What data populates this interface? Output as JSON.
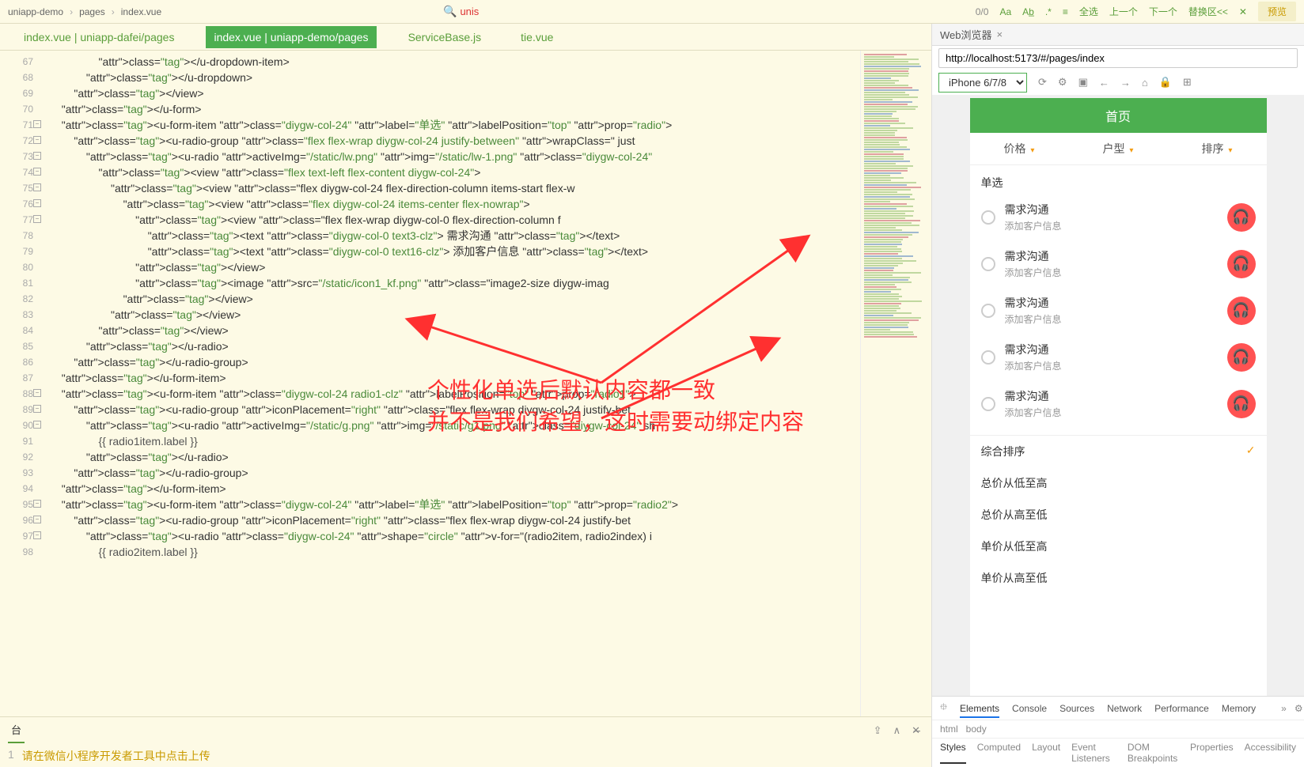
{
  "breadcrumb": [
    "uniapp-demo",
    "pages",
    "index.vue"
  ],
  "search_value": "unis",
  "match_count": "0/0",
  "toolbar_actions": {
    "select_all": "全选",
    "prev": "上一个",
    "next": "下一个",
    "replace": "替换区<<",
    "preview": "预览"
  },
  "editor_tabs": [
    {
      "label": "index.vue | uniapp-dafei/pages",
      "active": false
    },
    {
      "label": "index.vue | uniapp-demo/pages",
      "active": true
    },
    {
      "label": "ServiceBase.js",
      "active": false
    },
    {
      "label": "tie.vue",
      "active": false
    }
  ],
  "line_start": 67,
  "code_lines": [
    "              </u-dropdown-item>",
    "          </u-dropdown>",
    "      </view>",
    "  </u-form>",
    "  <u-form-item class=\"diygw-col-24\" label=\"单选\" labelPosition=\"top\" prop=\"radio\">",
    "      <u-radio-group class=\"flex flex-wrap diygw-col-24 justify-between\" wrapClass=\" just",
    "          <u-radio activeImg=\"/static/lw.png\" img=\"/static/lw-1.png\" class=\"diygw-col-24\"",
    "              <view class=\"flex text-left flex-content diygw-col-24\">",
    "                  <view class=\"flex diygw-col-24 flex-direction-column items-start flex-w",
    "                      <view class=\"flex diygw-col-24 items-center flex-nowrap\">",
    "                          <view class=\"flex flex-wrap diygw-col-0 flex-direction-column f",
    "                              <text class=\"diygw-col-0 text3-clz\"> 需求沟通 </text>",
    "                              <text class=\"diygw-col-0 text16-clz\"> 添加客户信息 </text>",
    "                          </view>",
    "                          <image src=\"/static/icon1_kf.png\" class=\"image2-size diygw-imag",
    "                      </view>",
    "                  </view>",
    "              </view>",
    "          </u-radio>",
    "      </u-radio-group>",
    "  </u-form-item>",
    "  <u-form-item class=\"diygw-col-24 radio1-clz\" labelPosition=\"top\" prop=\"radio1\">",
    "      <u-radio-group iconPlacement=\"right\" class=\"flex flex-wrap diygw-col-24 justify-bet",
    "          <u-radio activeImg=\"/static/g.png\" img=\"/static/g1.png\" class=\"diygw-col-24\" sh",
    "              {{ radio1item.label }}",
    "          </u-radio>",
    "      </u-radio-group>",
    "  </u-form-item>",
    "  <u-form-item class=\"diygw-col-24\" label=\"单选\" labelPosition=\"top\" prop=\"radio2\">",
    "      <u-radio-group iconPlacement=\"right\" class=\"flex flex-wrap diygw-col-24 justify-bet",
    "          <u-radio class=\"diygw-col-24\" shape=\"circle\" v-for=\"(radio2item, radio2index) i",
    "              {{ radio2item.label }}"
  ],
  "fold_lines": [
    71,
    72,
    73,
    74,
    75,
    76,
    77,
    88,
    89,
    90,
    95,
    96,
    97
  ],
  "annotation": {
    "line1": "个性化单选后默认内容都一致",
    "line2": "并不是我们希望，这时需要动绑定内容"
  },
  "console": {
    "tab": "台",
    "line_no": "1",
    "msg": "请在微信小程序开发者工具中点击上传"
  },
  "browser": {
    "tab": "Web浏览器",
    "url": "http://localhost:5173/#/pages/index",
    "device": "iPhone 6/7/8",
    "page_title": "首页",
    "filters": [
      "价格",
      "户型",
      "排序"
    ],
    "section": "单选",
    "items": [
      {
        "title": "需求沟通",
        "sub": "添加客户信息"
      },
      {
        "title": "需求沟通",
        "sub": "添加客户信息"
      },
      {
        "title": "需求沟通",
        "sub": "添加客户信息"
      },
      {
        "title": "需求沟通",
        "sub": "添加客户信息"
      },
      {
        "title": "需求沟通",
        "sub": "添加客户信息"
      }
    ],
    "sorts": [
      {
        "label": "综合排序",
        "checked": true
      },
      {
        "label": "总价从低至高",
        "checked": false
      },
      {
        "label": "总价从高至低",
        "checked": false
      },
      {
        "label": "单价从低至高",
        "checked": false
      },
      {
        "label": "单价从高至低",
        "checked": false
      }
    ]
  },
  "devtools": {
    "tabs": [
      "Elements",
      "Console",
      "Sources",
      "Network",
      "Performance",
      "Memory"
    ],
    "bc": [
      "html",
      "body"
    ],
    "sub": [
      "Styles",
      "Computed",
      "Layout",
      "Event Listeners",
      "DOM Breakpoints",
      "Properties",
      "Accessibility"
    ]
  }
}
